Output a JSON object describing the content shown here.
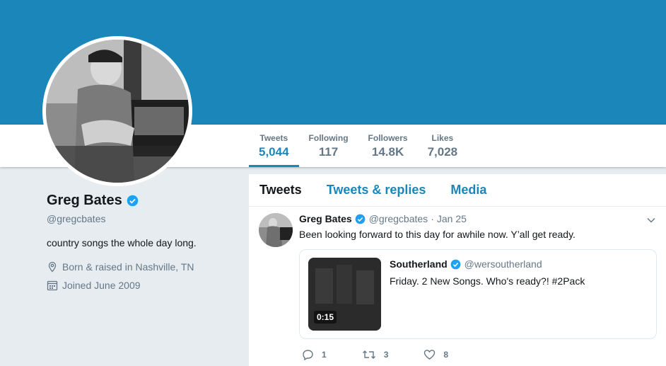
{
  "stats": [
    {
      "label": "Tweets",
      "value": "5,044"
    },
    {
      "label": "Following",
      "value": "117"
    },
    {
      "label": "Followers",
      "value": "14.8K"
    },
    {
      "label": "Likes",
      "value": "7,028"
    }
  ],
  "profile": {
    "name": "Greg Bates",
    "handle": "@gregcbates",
    "bio": "country songs the whole day long.",
    "location": "Born & raised in Nashville, TN",
    "joined": "Joined June 2009"
  },
  "tabs": [
    "Tweets",
    "Tweets & replies",
    "Media"
  ],
  "tweet": {
    "name": "Greg Bates",
    "handle": "@gregcbates",
    "separator": "·",
    "date": "Jan 25",
    "text": "Been looking forward to this day for awhile now. Y’all get ready.",
    "quote": {
      "name": "Southerland",
      "handle": "@wersoutherland",
      "text": "Friday. 2 New Songs. Who's ready?! #2Pack",
      "duration": "0:15"
    },
    "actions": {
      "replies": "1",
      "retweets": "3",
      "likes": "8"
    }
  },
  "colors": {
    "accent": "#1b86b9",
    "verified": "#1da1f2",
    "muted": "#657786"
  }
}
